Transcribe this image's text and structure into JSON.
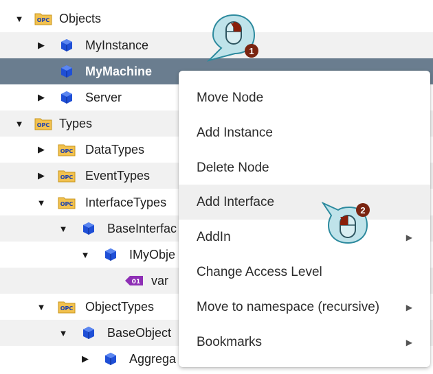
{
  "tree": {
    "rows": [
      {
        "label": "Objects",
        "icon": "opc-folder-icon",
        "caret": "▼"
      },
      {
        "label": "MyInstance",
        "icon": "object-cube-icon",
        "caret": "▶"
      },
      {
        "label": "MyMachine",
        "icon": "object-cube-icon",
        "caret": ""
      },
      {
        "label": "Server",
        "icon": "object-cube-icon",
        "caret": "▶"
      },
      {
        "label": "Types",
        "icon": "opc-folder-icon",
        "caret": "▼"
      },
      {
        "label": "DataTypes",
        "icon": "opc-folder-icon",
        "caret": "▶"
      },
      {
        "label": "EventTypes",
        "icon": "opc-folder-icon",
        "caret": "▶"
      },
      {
        "label": "InterfaceTypes",
        "icon": "opc-folder-icon",
        "caret": "▼"
      },
      {
        "label": "BaseInterfac",
        "icon": "object-cube-icon",
        "caret": "▼"
      },
      {
        "label": "IMyObje",
        "icon": "object-cube-icon",
        "caret": "▼"
      },
      {
        "label": "var",
        "icon": "variable-tag-icon",
        "caret": ""
      },
      {
        "label": "ObjectTypes",
        "icon": "opc-folder-icon",
        "caret": "▼"
      },
      {
        "label": "BaseObject",
        "icon": "object-cube-icon",
        "caret": "▼"
      },
      {
        "label": "Aggrega",
        "icon": "object-cube-icon",
        "caret": "▶"
      }
    ]
  },
  "folder_icon_text": "OPC",
  "variable_icon_text": "01",
  "context_menu": {
    "items": [
      {
        "label": "Move Node",
        "submenu": false
      },
      {
        "label": "Add Instance",
        "submenu": false
      },
      {
        "label": "Delete Node",
        "submenu": false
      },
      {
        "label": "Add Interface",
        "submenu": false
      },
      {
        "label": "AddIn",
        "submenu": true
      },
      {
        "label": "Change Access Level",
        "submenu": false
      },
      {
        "label": "Move to namespace (recursive)",
        "submenu": true
      },
      {
        "label": "Bookmarks",
        "submenu": true
      }
    ],
    "submenu_arrow": "▶"
  },
  "callouts": [
    {
      "number": "1",
      "icon": "right-click-mouse-icon"
    },
    {
      "number": "2",
      "icon": "left-click-mouse-icon"
    }
  ],
  "colors": {
    "selected_row": "#6a7d8f",
    "alt_row": "#f1f1f1",
    "cube_blue": "#1f4fd6",
    "folder_yellow": "#f2c14e",
    "badge_brown": "#7a2410",
    "callout_teal": "#bfe3ea"
  }
}
